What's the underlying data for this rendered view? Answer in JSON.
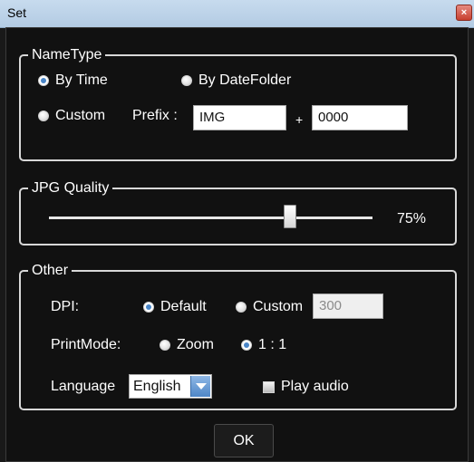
{
  "window": {
    "title": "Set",
    "close_label": "×"
  },
  "nametype": {
    "legend": "NameType",
    "by_time": "By Time",
    "by_datefolder": "By DateFolder",
    "custom": "Custom",
    "prefix_label": "Prefix :",
    "prefix_value": "IMG",
    "plus": "+",
    "counter_value": "0000",
    "selected": "By Time"
  },
  "jpg_quality": {
    "legend": "JPG Quality",
    "value": 75,
    "value_label": "75%"
  },
  "other": {
    "legend": "Other",
    "dpi_label": "DPI:",
    "dpi_default": "Default",
    "dpi_custom": "Custom",
    "dpi_custom_value": "300",
    "dpi_selected": "Default",
    "printmode_label": "PrintMode:",
    "printmode_zoom": "Zoom",
    "printmode_1to1": "1 : 1",
    "printmode_selected": "1 : 1",
    "language_label": "Language",
    "language_value": "English",
    "play_audio": "Play audio",
    "play_audio_checked": false
  },
  "footer": {
    "ok": "OK"
  },
  "colors": {
    "background": "#111111",
    "title_bar": "#b9d0e8",
    "accent": "#4a86c8",
    "border": "#d8d8d8"
  },
  "icons": {
    "close": "close-icon",
    "dropdown": "chevron-down-icon"
  }
}
